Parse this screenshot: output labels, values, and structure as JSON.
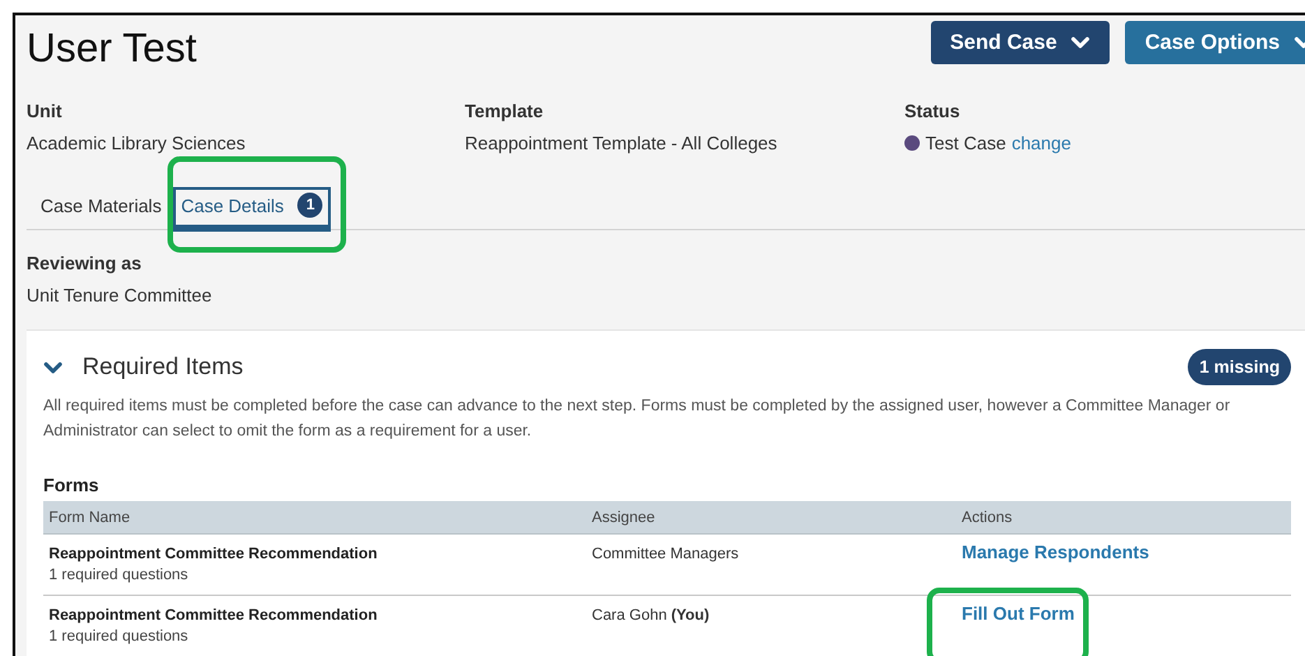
{
  "title": "User Test",
  "header_buttons": [
    {
      "label": "Send Case",
      "kind": "primary"
    },
    {
      "label": "Case Options",
      "kind": "secondary"
    }
  ],
  "fields": [
    {
      "label": "Unit",
      "value": "Academic Library Sciences"
    },
    {
      "label": "Template",
      "value": "Reappointment Template - All Colleges"
    },
    {
      "label": "Status",
      "value": "Test Case",
      "color": "#5a4a7e",
      "link": "change"
    }
  ],
  "tabs": [
    {
      "label": "Case Materials",
      "selected": false,
      "highlighted": false
    },
    {
      "label": "Case Details",
      "selected": true,
      "badge": "1",
      "highlighted": true
    }
  ],
  "reviewing": {
    "label": "Reviewing as",
    "value": "Unit Tenure Committee"
  },
  "required_items": {
    "title": "Required Items",
    "expanded": true,
    "badge": "1 missing",
    "description": "All required items must be completed before the case can advance to the next step. Forms must be completed by the assigned user, however a Committee Manager or Administrator can select to omit the form as a requirement for a user.",
    "forms": {
      "title": "Forms",
      "columns": [
        "Form Name",
        "Assignee",
        "Actions"
      ],
      "rows": [
        {
          "name": "Reappointment Committee Recommendation",
          "detail": "1 required questions",
          "assignee": "Committee Managers",
          "action": "Manage Respondents",
          "highlighted": false
        },
        {
          "name": "Reappointment Committee Recommendation",
          "detail": "1 required questions",
          "assignee": "Cara Gohn **(You)**",
          "action": "Fill Out Form",
          "highlighted": true
        }
      ]
    }
  }
}
